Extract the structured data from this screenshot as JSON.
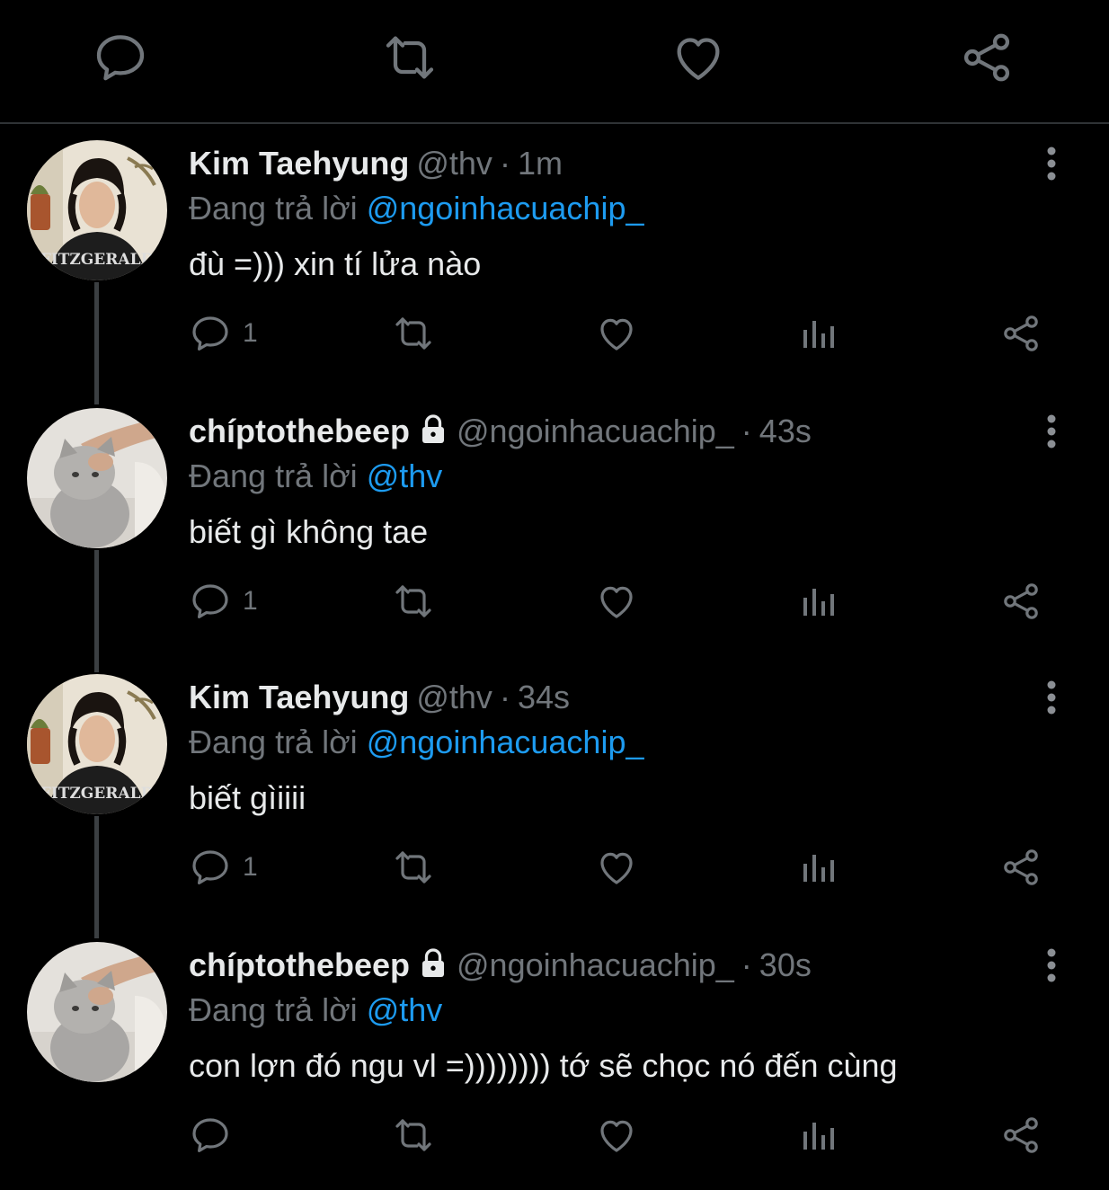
{
  "colors": {
    "background": "#000000",
    "text_primary": "#e7e9ea",
    "text_secondary": "#71767b",
    "mention": "#1d9bf0",
    "divider": "#2f3336"
  },
  "top_actions": [
    "reply-icon",
    "retweet-icon",
    "like-icon",
    "share-icon"
  ],
  "tweets": [
    {
      "name": "Kim Taehyung",
      "handle": "@thv",
      "separator": "·",
      "time": "1m",
      "reply_prefix": "Đang trả lời",
      "reply_to": "@ngoinhacuachip_",
      "text": "đù =))) xin tí lửa nào",
      "reply_count": "1",
      "protected": false,
      "avatar_icon": "avatar-photo-person"
    },
    {
      "name": "chíptothebeep",
      "handle": "@ngoinhacuachip_",
      "separator": "·",
      "time": "43s",
      "reply_prefix": "Đang trả lời",
      "reply_to": "@thv",
      "text": "biết gì không tae",
      "reply_count": "1",
      "protected": true,
      "avatar_icon": "avatar-photo-cat"
    },
    {
      "name": "Kim Taehyung",
      "handle": "@thv",
      "separator": "·",
      "time": "34s",
      "reply_prefix": "Đang trả lời",
      "reply_to": "@ngoinhacuachip_",
      "text": "biết gìiiii",
      "reply_count": "1",
      "protected": false,
      "avatar_icon": "avatar-photo-person"
    },
    {
      "name": "chíptothebeep",
      "handle": "@ngoinhacuachip_",
      "separator": "·",
      "time": "30s",
      "reply_prefix": "Đang trả lời",
      "reply_to": "@thv",
      "text": "con lợn đó ngu vl =)))))))) tớ sẽ chọc nó đến cùng",
      "reply_count": "",
      "protected": true,
      "avatar_icon": "avatar-photo-cat"
    }
  ]
}
